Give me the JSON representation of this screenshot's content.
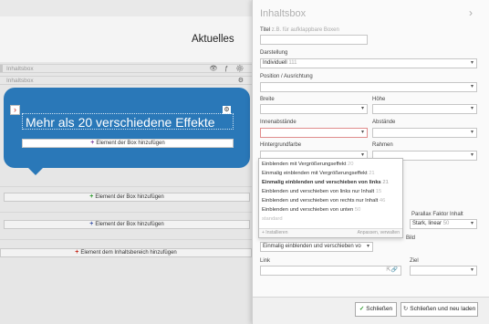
{
  "editor": {
    "heading": "Aktuelles",
    "bar1_label": "Inhaltsbox",
    "bar1_icons": "👁 ƒ ⚙",
    "bar2_label": "Inhaltsbox",
    "bar2_icons": "⚙",
    "box_title": "Mehr als 20 verschiedene Effekte",
    "add_element_box": "Element der Box hinzufügen",
    "add_element_content": "Element dem Inhaltsbereich hinzufügen"
  },
  "panel": {
    "title": "Inhaltsbox",
    "chevron": "›",
    "title_label": "Titel",
    "title_hint": "z.B. für aufklappbare Boxen",
    "title_value": "",
    "darstellung_label": "Darstellung",
    "darstellung_value": "Individuell",
    "darstellung_count": "111",
    "position_label": "Position / Ausrichtung",
    "breite_label": "Breite",
    "hoehe_label": "Höhe",
    "innenabstaende_label": "Innenabstände",
    "abstaende_label": "Abstände",
    "hintergrundfarbe_label": "Hintergrundfarbe",
    "rahmen_label": "Rahmen",
    "dropdown_options": [
      {
        "label": "Einblenden mit Vergrößerungseffekt",
        "count": "20"
      },
      {
        "label": "Einmalig einblenden mit Vergrößerungseffekt",
        "count": "21"
      },
      {
        "label": "Einmalig einblenden und verschieben von links",
        "count": "21"
      },
      {
        "label": "Einblenden und verschieben von links nur Inhalt",
        "count": "15"
      },
      {
        "label": "Einblenden und verschieben von rechts nur Inhalt",
        "count": "46"
      },
      {
        "label": "Einblenden und verschieben von unten",
        "count": "50"
      },
      {
        "label": "standard",
        "count": ""
      }
    ],
    "dropdown_install": "+ Installieren",
    "dropdown_adjust": "Anpassen, verwalten",
    "parallax_label": "Parallax Faktor Inhalt",
    "parallax_value": "Stark, linear",
    "parallax_count": "50",
    "bild_label_suffix": "Bild",
    "effect_value": "Einmalig einblenden und verschieben vo",
    "link_label": "Link",
    "ziel_label": "Ziel",
    "close_button": "Schließen",
    "close_reload_button": "Schließen und neu laden"
  }
}
